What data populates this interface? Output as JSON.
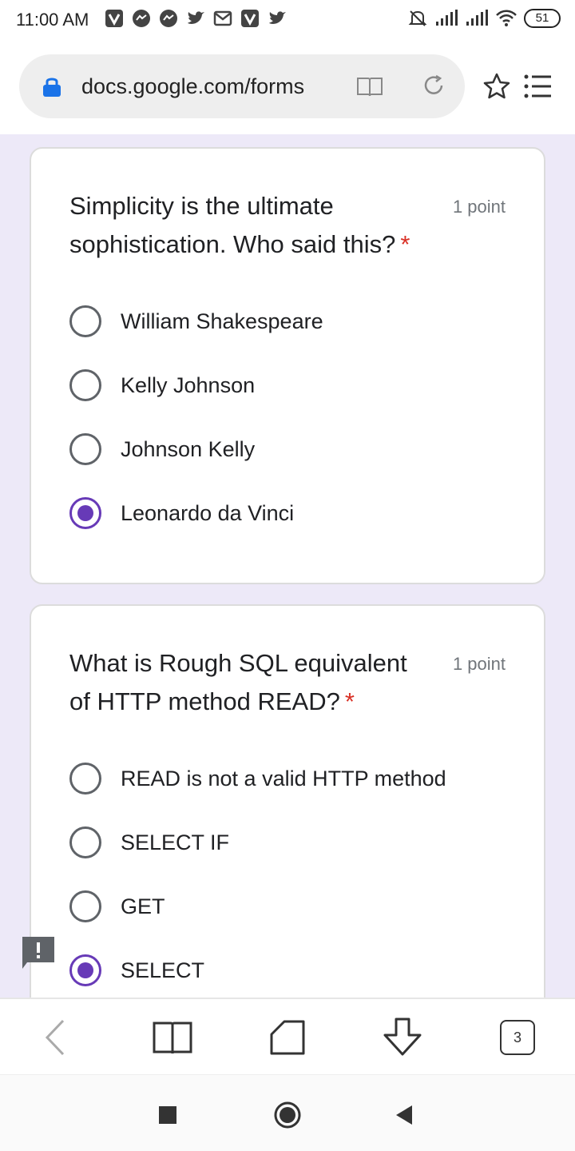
{
  "status_bar": {
    "time": "11:00 AM",
    "battery": "51"
  },
  "browser": {
    "url": "docs.google.com/forms",
    "tab_count": "3"
  },
  "form": {
    "questions": [
      {
        "title": "Simplicity is the ultimate sophistication. Who said this?",
        "required_mark": "*",
        "points": "1 point",
        "options": [
          {
            "label": "William Shakespeare",
            "selected": false
          },
          {
            "label": "Kelly Johnson",
            "selected": false
          },
          {
            "label": "Johnson Kelly",
            "selected": false
          },
          {
            "label": "Leonardo da Vinci",
            "selected": true
          }
        ]
      },
      {
        "title": "What is Rough SQL equivalent of HTTP method READ?",
        "required_mark": "*",
        "points": "1 point",
        "options": [
          {
            "label": "READ is not a valid HTTP method",
            "selected": false
          },
          {
            "label": "SELECT IF",
            "selected": false
          },
          {
            "label": "GET",
            "selected": false
          },
          {
            "label": "SELECT",
            "selected": true
          }
        ]
      }
    ]
  },
  "colors": {
    "accent": "#673ab7",
    "required": "#d93025",
    "page_background": "#ede9f8"
  }
}
